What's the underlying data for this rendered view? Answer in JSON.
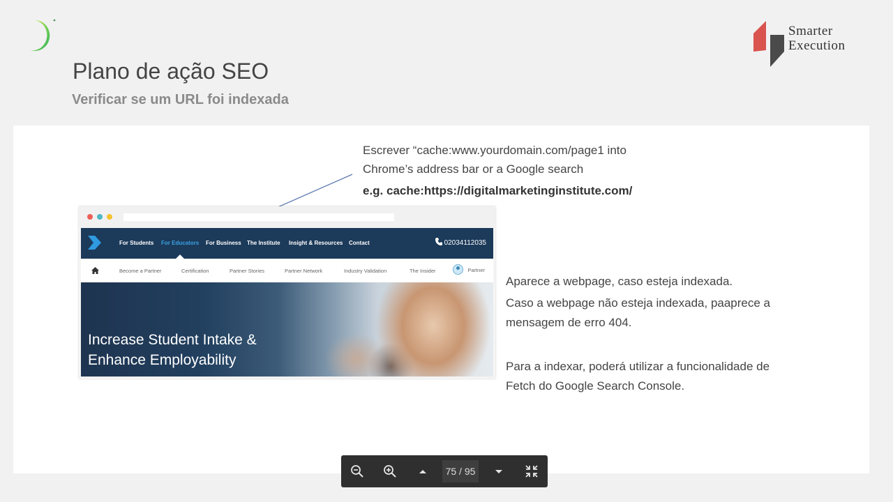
{
  "slide": {
    "title": "Plano de ação SEO",
    "subtitle": "Verificar se um URL foi indexada"
  },
  "brand": {
    "name_line1": "Smarter",
    "name_line2": "Execution",
    "left_logo_icon": "crescent-logo-icon",
    "accent_green": "#7ed321",
    "accent_red": "#d9534f"
  },
  "instructions": {
    "line1": "Escrever “cache:www.yourdomain.com/page1  into",
    "line2": "Chrome’s address bar or a Google search",
    "example": "e.g. cache:https://digitalmarketinginstitute.com/"
  },
  "screenshot": {
    "nav": [
      "For Students",
      "For Educators",
      "For Business",
      "The Institute",
      "Insight & Resources",
      "Contact"
    ],
    "active_nav": "For Educators",
    "phone": "02034112035",
    "sub_nav": [
      "Become a Partner",
      "Certification",
      "Partner Stories",
      "Partner Network",
      "Industry Validation",
      "The Insider"
    ],
    "partner": "Partner",
    "hero_line1": "Increase Student Intake &",
    "hero_line2": "Enhance Employability",
    "nav_color": "#1c3a5a"
  },
  "notes": {
    "p1": "Aparece a webpage, caso esteja indexada.",
    "p2": "Caso a webpage não esteja indexada, paaprece a mensagem de erro 404.",
    "p3": "Para a indexar, poderá utilizar a funcionalidade de Fetch do Google Search Console."
  },
  "viewer": {
    "page_indicator": "75 / 95"
  }
}
